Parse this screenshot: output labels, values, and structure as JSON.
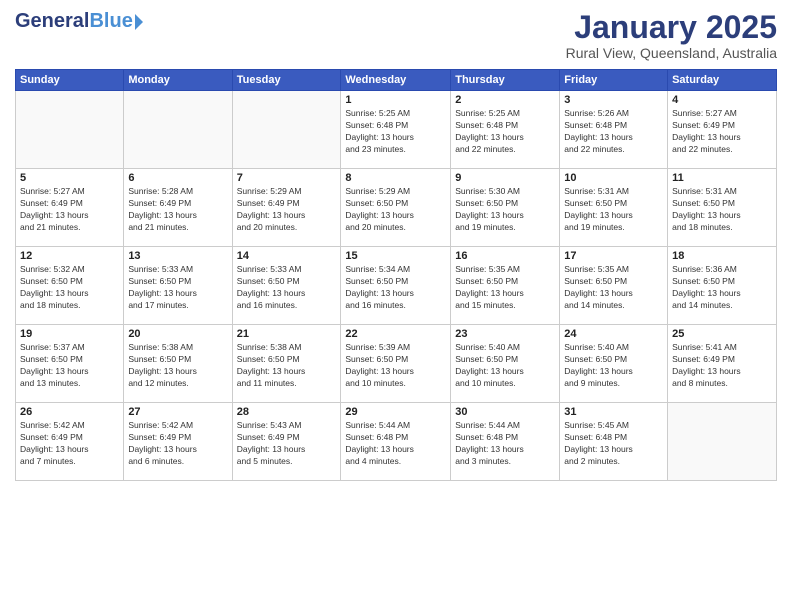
{
  "header": {
    "logo_general": "General",
    "logo_blue": "Blue",
    "month_title": "January 2025",
    "subtitle": "Rural View, Queensland, Australia"
  },
  "days_of_week": [
    "Sunday",
    "Monday",
    "Tuesday",
    "Wednesday",
    "Thursday",
    "Friday",
    "Saturday"
  ],
  "weeks": [
    [
      {
        "day": "",
        "info": ""
      },
      {
        "day": "",
        "info": ""
      },
      {
        "day": "",
        "info": ""
      },
      {
        "day": "1",
        "info": "Sunrise: 5:25 AM\nSunset: 6:48 PM\nDaylight: 13 hours\nand 23 minutes."
      },
      {
        "day": "2",
        "info": "Sunrise: 5:25 AM\nSunset: 6:48 PM\nDaylight: 13 hours\nand 22 minutes."
      },
      {
        "day": "3",
        "info": "Sunrise: 5:26 AM\nSunset: 6:48 PM\nDaylight: 13 hours\nand 22 minutes."
      },
      {
        "day": "4",
        "info": "Sunrise: 5:27 AM\nSunset: 6:49 PM\nDaylight: 13 hours\nand 22 minutes."
      }
    ],
    [
      {
        "day": "5",
        "info": "Sunrise: 5:27 AM\nSunset: 6:49 PM\nDaylight: 13 hours\nand 21 minutes."
      },
      {
        "day": "6",
        "info": "Sunrise: 5:28 AM\nSunset: 6:49 PM\nDaylight: 13 hours\nand 21 minutes."
      },
      {
        "day": "7",
        "info": "Sunrise: 5:29 AM\nSunset: 6:49 PM\nDaylight: 13 hours\nand 20 minutes."
      },
      {
        "day": "8",
        "info": "Sunrise: 5:29 AM\nSunset: 6:50 PM\nDaylight: 13 hours\nand 20 minutes."
      },
      {
        "day": "9",
        "info": "Sunrise: 5:30 AM\nSunset: 6:50 PM\nDaylight: 13 hours\nand 19 minutes."
      },
      {
        "day": "10",
        "info": "Sunrise: 5:31 AM\nSunset: 6:50 PM\nDaylight: 13 hours\nand 19 minutes."
      },
      {
        "day": "11",
        "info": "Sunrise: 5:31 AM\nSunset: 6:50 PM\nDaylight: 13 hours\nand 18 minutes."
      }
    ],
    [
      {
        "day": "12",
        "info": "Sunrise: 5:32 AM\nSunset: 6:50 PM\nDaylight: 13 hours\nand 18 minutes."
      },
      {
        "day": "13",
        "info": "Sunrise: 5:33 AM\nSunset: 6:50 PM\nDaylight: 13 hours\nand 17 minutes."
      },
      {
        "day": "14",
        "info": "Sunrise: 5:33 AM\nSunset: 6:50 PM\nDaylight: 13 hours\nand 16 minutes."
      },
      {
        "day": "15",
        "info": "Sunrise: 5:34 AM\nSunset: 6:50 PM\nDaylight: 13 hours\nand 16 minutes."
      },
      {
        "day": "16",
        "info": "Sunrise: 5:35 AM\nSunset: 6:50 PM\nDaylight: 13 hours\nand 15 minutes."
      },
      {
        "day": "17",
        "info": "Sunrise: 5:35 AM\nSunset: 6:50 PM\nDaylight: 13 hours\nand 14 minutes."
      },
      {
        "day": "18",
        "info": "Sunrise: 5:36 AM\nSunset: 6:50 PM\nDaylight: 13 hours\nand 14 minutes."
      }
    ],
    [
      {
        "day": "19",
        "info": "Sunrise: 5:37 AM\nSunset: 6:50 PM\nDaylight: 13 hours\nand 13 minutes."
      },
      {
        "day": "20",
        "info": "Sunrise: 5:38 AM\nSunset: 6:50 PM\nDaylight: 13 hours\nand 12 minutes."
      },
      {
        "day": "21",
        "info": "Sunrise: 5:38 AM\nSunset: 6:50 PM\nDaylight: 13 hours\nand 11 minutes."
      },
      {
        "day": "22",
        "info": "Sunrise: 5:39 AM\nSunset: 6:50 PM\nDaylight: 13 hours\nand 10 minutes."
      },
      {
        "day": "23",
        "info": "Sunrise: 5:40 AM\nSunset: 6:50 PM\nDaylight: 13 hours\nand 10 minutes."
      },
      {
        "day": "24",
        "info": "Sunrise: 5:40 AM\nSunset: 6:50 PM\nDaylight: 13 hours\nand 9 minutes."
      },
      {
        "day": "25",
        "info": "Sunrise: 5:41 AM\nSunset: 6:49 PM\nDaylight: 13 hours\nand 8 minutes."
      }
    ],
    [
      {
        "day": "26",
        "info": "Sunrise: 5:42 AM\nSunset: 6:49 PM\nDaylight: 13 hours\nand 7 minutes."
      },
      {
        "day": "27",
        "info": "Sunrise: 5:42 AM\nSunset: 6:49 PM\nDaylight: 13 hours\nand 6 minutes."
      },
      {
        "day": "28",
        "info": "Sunrise: 5:43 AM\nSunset: 6:49 PM\nDaylight: 13 hours\nand 5 minutes."
      },
      {
        "day": "29",
        "info": "Sunrise: 5:44 AM\nSunset: 6:48 PM\nDaylight: 13 hours\nand 4 minutes."
      },
      {
        "day": "30",
        "info": "Sunrise: 5:44 AM\nSunset: 6:48 PM\nDaylight: 13 hours\nand 3 minutes."
      },
      {
        "day": "31",
        "info": "Sunrise: 5:45 AM\nSunset: 6:48 PM\nDaylight: 13 hours\nand 2 minutes."
      },
      {
        "day": "",
        "info": ""
      }
    ]
  ]
}
